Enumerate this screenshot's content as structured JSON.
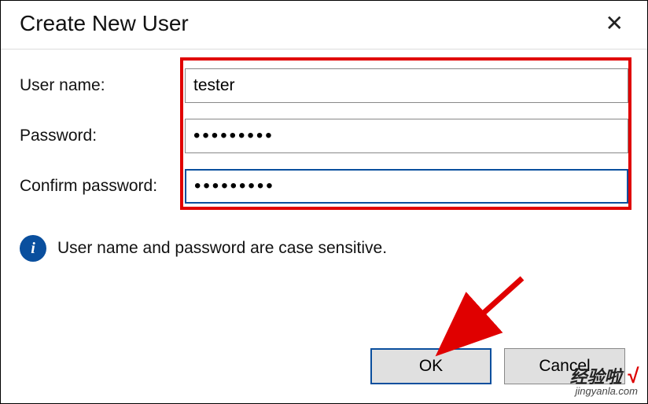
{
  "dialog": {
    "title": "Create New User",
    "close_label": "✕"
  },
  "form": {
    "username_label": "User name:",
    "username_value": "tester",
    "password_label": "Password:",
    "password_value": "•••••••••",
    "confirm_label": "Confirm password:",
    "confirm_value": "•••••••••"
  },
  "info": {
    "icon_glyph": "i",
    "text": "User name and password are case sensitive."
  },
  "buttons": {
    "ok_label": "OK",
    "cancel_label": "Cancel"
  },
  "watermark": {
    "main": "经验啦",
    "check": "√",
    "sub": "jingyanla.com"
  }
}
